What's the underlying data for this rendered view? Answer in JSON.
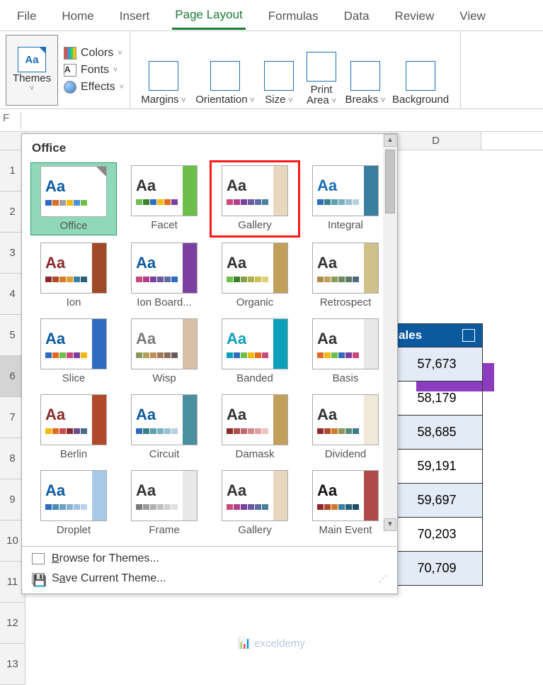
{
  "tabs": [
    "File",
    "Home",
    "Insert",
    "Page Layout",
    "Formulas",
    "Data",
    "Review",
    "View"
  ],
  "active_tab": "Page Layout",
  "ribbon": {
    "themes_label": "Themes",
    "colors_label": "Colors",
    "fonts_label": "Fonts",
    "effects_label": "Effects",
    "margins_label": "Margins",
    "orientation_label": "Orientation",
    "size_label": "Size",
    "print_area_label": "Print Area",
    "breaks_label": "Breaks",
    "background_label": "Background"
  },
  "theme_panel": {
    "section": "Office",
    "items": [
      {
        "label": "Office",
        "aa_color": "#0b5aa0",
        "swatches": [
          "#2f6bbf",
          "#e06b1f",
          "#a0a0a0",
          "#f2b90f",
          "#4a90d9",
          "#6bbf4a"
        ],
        "selected": true,
        "highlighted": false,
        "fold": true,
        "stripe": null
      },
      {
        "label": "Facet",
        "aa_color": "#333",
        "swatches": [
          "#6bbf4a",
          "#3a7f2a",
          "#2f6bbf",
          "#f2b90f",
          "#e06b1f",
          "#7b3fa0"
        ],
        "selected": false,
        "highlighted": false,
        "fold": true,
        "stripe": "#6bbf4a"
      },
      {
        "label": "Gallery",
        "aa_color": "#333",
        "swatches": [
          "#c94a7a",
          "#b03f8a",
          "#7b3fa0",
          "#6a5a9f",
          "#5a6fa0",
          "#4a7fa0"
        ],
        "selected": false,
        "highlighted": true,
        "fold": true,
        "stripe": "#e8d8c0"
      },
      {
        "label": "Integral",
        "aa_color": "#1a6fb8",
        "swatches": [
          "#2f6bbf",
          "#3a7f8a",
          "#5a9fb0",
          "#7ab0c0",
          "#9ac0d0",
          "#b8d0df"
        ],
        "selected": false,
        "highlighted": false,
        "fold": true,
        "stripe": "#3a7fa0"
      },
      {
        "label": "Ion",
        "aa_color": "#8a2a2a",
        "swatches": [
          "#8a2a2a",
          "#b04a2a",
          "#d07a2a",
          "#e0a02a",
          "#3a7fa0",
          "#2a5f7a"
        ],
        "selected": false,
        "highlighted": false,
        "fold": true,
        "stripe": "#a04a2a"
      },
      {
        "label": "Ion Board...",
        "aa_color": "#0b5aa0",
        "swatches": [
          "#c94a7a",
          "#b03f8a",
          "#7b3fa0",
          "#6a5a9f",
          "#5a6fa0",
          "#2f6bbf"
        ],
        "selected": false,
        "highlighted": false,
        "fold": true,
        "stripe": "#7b3fa0"
      },
      {
        "label": "Organic",
        "aa_color": "#333",
        "swatches": [
          "#6bbf4a",
          "#3a7f2a",
          "#8aa04a",
          "#b0b04a",
          "#d0c05a",
          "#e0d07a"
        ],
        "selected": false,
        "highlighted": false,
        "fold": true,
        "stripe": "#c0a05a"
      },
      {
        "label": "Retrospect",
        "aa_color": "#333",
        "swatches": [
          "#b08a4a",
          "#c0a05a",
          "#8a9a5a",
          "#6a8a5a",
          "#5a7a6a",
          "#4a6a7a"
        ],
        "selected": false,
        "highlighted": false,
        "fold": true,
        "stripe": "#d0c08a"
      },
      {
        "label": "Slice",
        "aa_color": "#0b5aa0",
        "swatches": [
          "#2f6bbf",
          "#e06b1f",
          "#6bbf4a",
          "#c94a7a",
          "#7b3fa0",
          "#f2b90f"
        ],
        "selected": false,
        "highlighted": false,
        "fold": true,
        "stripe": "#2f6bbf"
      },
      {
        "label": "Wisp",
        "aa_color": "#7a7a7a",
        "swatches": [
          "#8a9a5a",
          "#b0a05a",
          "#c0905a",
          "#a07a5a",
          "#8a6a5a",
          "#6a5a5a"
        ],
        "selected": false,
        "highlighted": false,
        "fold": true,
        "stripe": "#d8c0a8"
      },
      {
        "label": "Banded",
        "aa_color": "#0aa0b8",
        "swatches": [
          "#0aa0b8",
          "#2f6bbf",
          "#6bbf4a",
          "#f2b90f",
          "#e06b1f",
          "#c94a7a"
        ],
        "selected": false,
        "highlighted": false,
        "fold": true,
        "stripe": "#0aa0b8"
      },
      {
        "label": "Basis",
        "aa_color": "#333",
        "swatches": [
          "#e06b1f",
          "#f2b90f",
          "#6bbf4a",
          "#2f6bbf",
          "#7b3fa0",
          "#c94a7a"
        ],
        "selected": false,
        "highlighted": false,
        "fold": true,
        "stripe": "#e8e8e8"
      },
      {
        "label": "Berlin",
        "aa_color": "#8a2a2a",
        "swatches": [
          "#f2b90f",
          "#e06b1f",
          "#c94a4a",
          "#8a2a2a",
          "#6a4a8a",
          "#4a6a8a"
        ],
        "selected": false,
        "highlighted": false,
        "fold": true,
        "stripe": "#b04a2a"
      },
      {
        "label": "Circuit",
        "aa_color": "#0b5aa0",
        "swatches": [
          "#2f6bbf",
          "#3a7f8a",
          "#5a9fb0",
          "#7ab0c0",
          "#9ac0d0",
          "#b8d0df"
        ],
        "selected": false,
        "highlighted": false,
        "fold": true,
        "stripe": "#4a8fa0"
      },
      {
        "label": "Damask",
        "aa_color": "#333",
        "swatches": [
          "#8a2a2a",
          "#b04a4a",
          "#c06a6a",
          "#d08a8a",
          "#e0a0a0",
          "#f0c0c0"
        ],
        "selected": false,
        "highlighted": false,
        "fold": true,
        "stripe": "#c0a05a"
      },
      {
        "label": "Dividend",
        "aa_color": "#333",
        "swatches": [
          "#8a2a2a",
          "#b04a2a",
          "#d07a2a",
          "#8a9a5a",
          "#5a8a7a",
          "#3a7a8a"
        ],
        "selected": false,
        "highlighted": false,
        "fold": true,
        "stripe": "#f0e8d8"
      },
      {
        "label": "Droplet",
        "aa_color": "#0b5aa0",
        "swatches": [
          "#2f6bbf",
          "#4a8fb0",
          "#6aa0c0",
          "#8ab0d0",
          "#a0c0e0",
          "#c0d0f0"
        ],
        "selected": false,
        "highlighted": false,
        "fold": true,
        "stripe": "#a8c8e8"
      },
      {
        "label": "Frame",
        "aa_color": "#333",
        "swatches": [
          "#7a7a7a",
          "#9a9a9a",
          "#b0b0b0",
          "#c0c0c0",
          "#d0d0d0",
          "#e0e0e0"
        ],
        "selected": false,
        "highlighted": false,
        "fold": true,
        "stripe": "#e8e8e8"
      },
      {
        "label": "Gallery",
        "aa_color": "#333",
        "swatches": [
          "#c94a7a",
          "#b03f8a",
          "#7b3fa0",
          "#6a5a9f",
          "#5a6fa0",
          "#4a7fa0"
        ],
        "selected": false,
        "highlighted": false,
        "fold": true,
        "stripe": "#e8d8c0"
      },
      {
        "label": "Main Event",
        "aa_color": "#111",
        "swatches": [
          "#8a2a2a",
          "#b04a2a",
          "#d07a2a",
          "#3a7fa0",
          "#2a5f7a",
          "#1a4f6a"
        ],
        "selected": false,
        "highlighted": false,
        "fold": true,
        "stripe": "#b04a4a"
      }
    ],
    "browse_label": "Browse for Themes...",
    "save_label": "Save Current Theme..."
  },
  "col_header_visible": "D",
  "sales": {
    "header": "ales",
    "values": [
      "57,673",
      "58,179",
      "58,685",
      "59,191",
      "59,697",
      "70,203",
      "70,709"
    ]
  },
  "row_numbers": [
    "1",
    "2",
    "3",
    "4",
    "5",
    "6",
    "7",
    "8",
    "9",
    "10",
    "11",
    "12",
    "13"
  ],
  "watermark": "exceldemy"
}
